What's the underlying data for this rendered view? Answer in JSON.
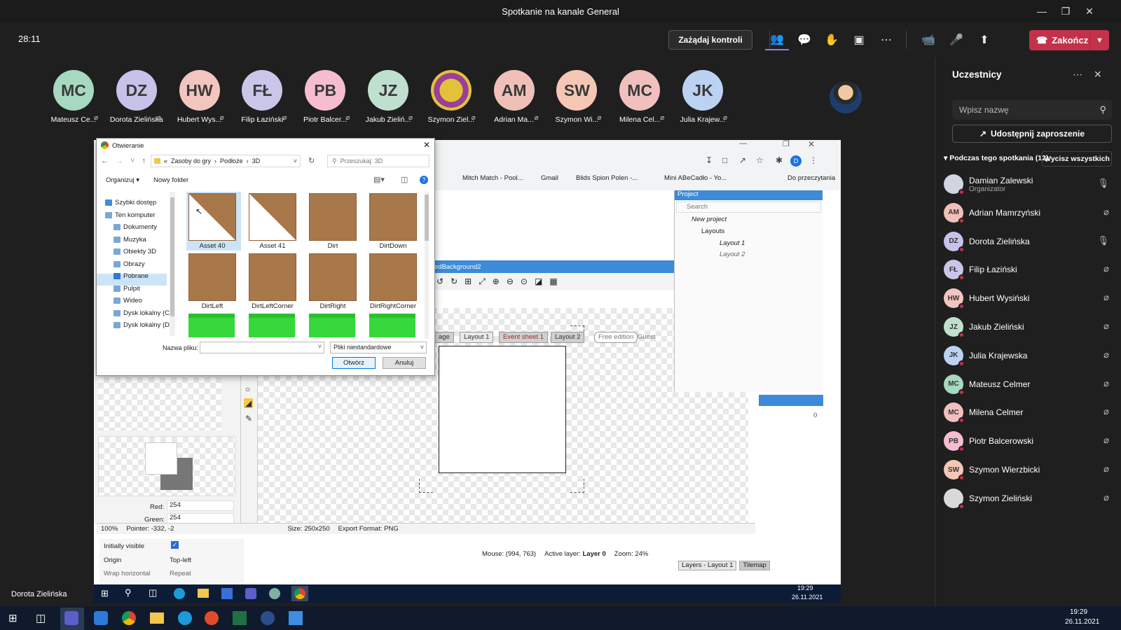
{
  "window": {
    "title": "Spotkanie na kanale General"
  },
  "meeting": {
    "timer": "28:11",
    "control_button": "Zażądaj kontroli",
    "end_button": "Zakończ",
    "presenter_label": "Dorota Zielińska"
  },
  "participants_strip": [
    {
      "initials": "MC",
      "name": "Mateusz Ce...",
      "color": "#a7d8c0"
    },
    {
      "initials": "DZ",
      "name": "Dorota Zielińska",
      "color": "#c7c2ea"
    },
    {
      "initials": "HW",
      "name": "Hubert Wys...",
      "color": "#f2c5bf"
    },
    {
      "initials": "FŁ",
      "name": "Filip Łaziński",
      "color": "#c9c6e9"
    },
    {
      "initials": "PB",
      "name": "Piotr Balcer...",
      "color": "#f6bcd0"
    },
    {
      "initials": "JZ",
      "name": "Jakub Zieliń...",
      "color": "#bfe0cf"
    },
    {
      "initials": "",
      "name": "Szymon Ziel...",
      "color": "#d9d9d9"
    },
    {
      "initials": "AM",
      "name": "Adrian Ma...",
      "color": "#f0c0b8"
    },
    {
      "initials": "SW",
      "name": "Szymon Wi...",
      "color": "#f6c6b4"
    },
    {
      "initials": "MC",
      "name": "Milena Cel...",
      "color": "#f2bfbf"
    },
    {
      "initials": "JK",
      "name": "Julia Krajew...",
      "color": "#bcd2f2"
    }
  ],
  "panel": {
    "title": "Uczestnicy",
    "search_placeholder": "Wpisz nazwę",
    "share_button": "Udostępnij zaproszenie",
    "section_label": "Podczas tego spotkania (12)",
    "mute_all": "Wycisz wszystkich",
    "people": [
      {
        "initials": "",
        "name": "Damian Zalewski",
        "role": "Organizator",
        "color": "#cfd6e2",
        "mic": "on"
      },
      {
        "initials": "AM",
        "name": "Adrian Mamrzyński",
        "role": "",
        "color": "#f0c0b8",
        "mic": "off"
      },
      {
        "initials": "DZ",
        "name": "Dorota Zielińska",
        "role": "",
        "color": "#c7c2ea",
        "mic": "on"
      },
      {
        "initials": "FŁ",
        "name": "Filip Łaziński",
        "role": "",
        "color": "#c9c6e9",
        "mic": "off"
      },
      {
        "initials": "HW",
        "name": "Hubert Wysiński",
        "role": "",
        "color": "#f2c5bf",
        "mic": "off"
      },
      {
        "initials": "JZ",
        "name": "Jakub Zieliński",
        "role": "",
        "color": "#bfe0cf",
        "mic": "off"
      },
      {
        "initials": "JK",
        "name": "Julia Krajewska",
        "role": "",
        "color": "#bcd2f2",
        "mic": "off"
      },
      {
        "initials": "MC",
        "name": "Mateusz Celmer",
        "role": "",
        "color": "#a7d8c0",
        "mic": "off"
      },
      {
        "initials": "MC",
        "name": "Milena Celmer",
        "role": "",
        "color": "#f2bfbf",
        "mic": "off"
      },
      {
        "initials": "PB",
        "name": "Piotr Balcerowski",
        "role": "",
        "color": "#f6bcd0",
        "mic": "off"
      },
      {
        "initials": "SW",
        "name": "Szymon Wierzbicki",
        "role": "",
        "color": "#f6c6b4",
        "mic": "off"
      },
      {
        "initials": "",
        "name": "Szymon Zieliński",
        "role": "",
        "color": "#d9d9d9",
        "mic": "off"
      }
    ]
  },
  "dialog": {
    "title": "Otwieranie",
    "breadcrumb": [
      "Zasoby do gry",
      "Podłoże",
      "3D"
    ],
    "search_placeholder": "Przeszukaj: 3D",
    "organize": "Organizuj",
    "new_folder": "Nowy folder",
    "sidebar": [
      "Szybki dostęp",
      "Ten komputer",
      "Dokumenty",
      "Muzyka",
      "Obiekty 3D",
      "Obrazy",
      "Pobrane",
      "Pulpit",
      "Wideo",
      "Dysk lokalny (C:)",
      "Dysk lokalny (D:)"
    ],
    "files": [
      "Asset 40",
      "Asset 41",
      "Dirt",
      "DirtDown",
      "DirtLeft",
      "DirtLeftCorner",
      "DirtRight",
      "DirtRightCorner"
    ],
    "filename_label": "Nazwa pliku:",
    "filetype": "Pliki niestandardowe",
    "open": "Otwórz",
    "cancel": "Anuluj"
  },
  "browser": {
    "bookmarks": [
      "Mitch Match - Pool...",
      "Gmail",
      "Blids Spion Polen -...",
      "Mini ABeCadło - Yo...",
      "Do przeczytania"
    ],
    "profile": "D"
  },
  "editor": {
    "tabs": [
      "age",
      "Layout 1",
      "Event sheet 1",
      "Layout 2"
    ],
    "free_edition": "Free edition",
    "guest": "Guest",
    "project_title": "Project",
    "project_search": "Search",
    "tree": [
      "New project",
      "Layouts",
      "Layout 1",
      "Layout 2"
    ],
    "image_editor_title": "edBackground2",
    "zoom": "100%",
    "pointer": "Pointer: -332, -2",
    "size": "Size: 250x250",
    "export": "Export Format: PNG",
    "red_label": "Red:",
    "red": "254",
    "green_label": "Green:",
    "green": "254",
    "prop_visible": "Initially visible",
    "prop_origin": "Origin",
    "origin_value": "Top-left",
    "prop_wrap": "Wrap horizontal",
    "wrap_value": "Repeat",
    "mouse": "Mouse: (994, 763)",
    "active_layer_label": "Active layer:",
    "active_layer": "Layer 0",
    "zoom_label": "Zoom: 24%",
    "bottom_tabs": [
      "Layers - Layout 1",
      "Tilemap"
    ],
    "zero": "0"
  },
  "remote_clock": {
    "time": "19:29",
    "date": "26.11.2021"
  },
  "os_clock": {
    "time": "19:29",
    "date": "26.11.2021"
  }
}
